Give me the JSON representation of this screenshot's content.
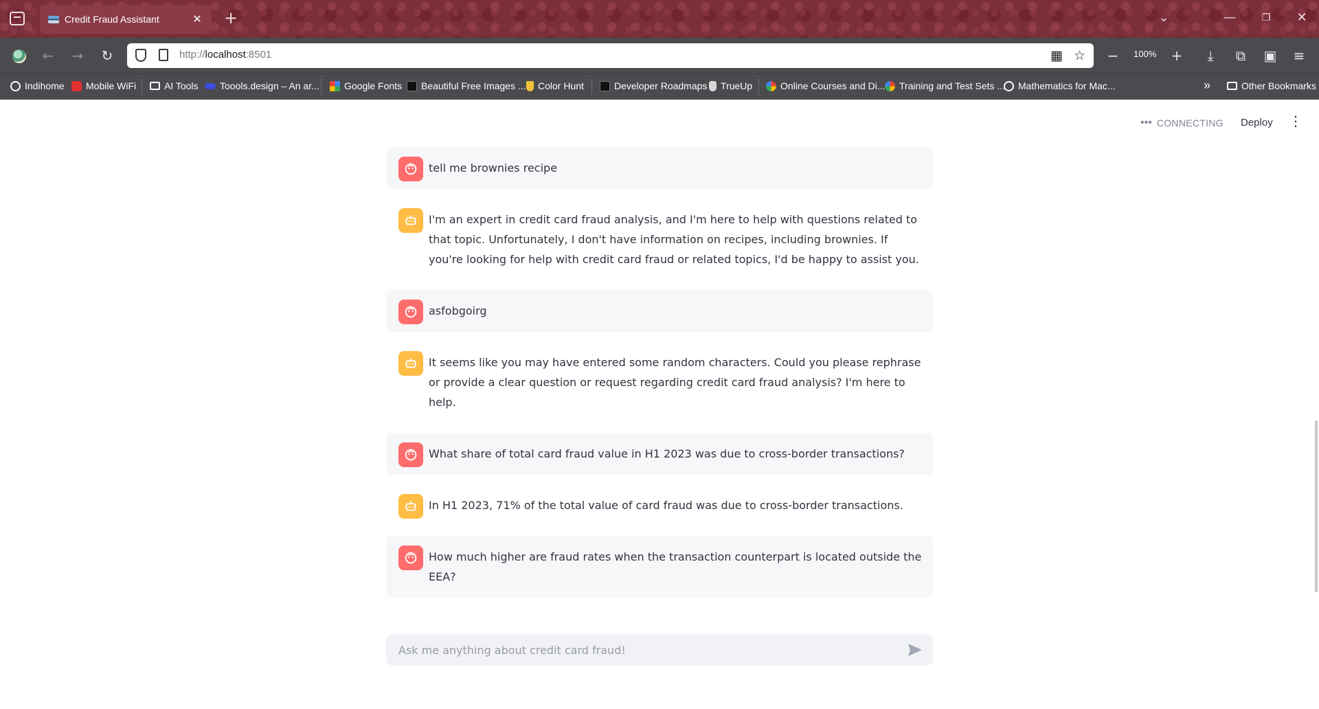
{
  "browser": {
    "tab_title": "Credit Fraud Assistant",
    "url_scheme": "http://",
    "url_host": "localhost",
    "url_port": ":8501",
    "zoom": "100%",
    "bookmarks": [
      {
        "label": "Indihome",
        "icon": "globe-icon"
      },
      {
        "label": "Mobile WiFi",
        "icon": "huawei-icon"
      },
      {
        "label": "AI Tools",
        "icon": "folder-icon"
      },
      {
        "label": "Toools.design – An ar...",
        "icon": "toools-icon"
      },
      {
        "label": "Google Fonts",
        "icon": "google-fonts-icon"
      },
      {
        "label": "Beautiful Free Images ...",
        "icon": "unsplash-icon"
      },
      {
        "label": "Color Hunt",
        "icon": "color-hunt-icon"
      },
      {
        "label": "Developer Roadmaps",
        "icon": "roadmap-icon"
      },
      {
        "label": "TrueUp",
        "icon": "trueup-icon"
      },
      {
        "label": "Online Courses and Di...",
        "icon": "google-icon"
      },
      {
        "label": "Training and Test Sets ...",
        "icon": "google-icon"
      },
      {
        "label": "Mathematics for Mac...",
        "icon": "globe-icon"
      }
    ],
    "other_bookmarks": "Other Bookmarks"
  },
  "app": {
    "status": "CONNECTING",
    "deploy_label": "Deploy",
    "messages": [
      {
        "role": "user",
        "text": "tell me brownies recipe"
      },
      {
        "role": "assistant",
        "text": "I'm an expert in credit card fraud analysis, and I'm here to help with questions related to that topic. Unfortunately, I don't have information on recipes, including brownies. If you're looking for help with credit card fraud or related topics, I'd be happy to assist you."
      },
      {
        "role": "user",
        "text": "asfobgoirg"
      },
      {
        "role": "assistant",
        "text": "It seems like you may have entered some random characters. Could you please rephrase or provide a clear question or request regarding credit card fraud analysis? I'm here to help."
      },
      {
        "role": "user",
        "text": "What share of total card fraud value in H1 2023 was due to cross-border transactions?"
      },
      {
        "role": "assistant",
        "text": "In H1 2023, 71% of the total value of card fraud was due to cross-border transactions."
      },
      {
        "role": "user",
        "text": "How much higher are fraud rates when the transaction counterpart is located outside the EEA?"
      }
    ],
    "chat_input": {
      "placeholder": "Ask me anything about credit card fraud!",
      "value": ""
    },
    "colors": {
      "user_avatar": "#ff6c6c",
      "assistant_avatar": "#ffbd45",
      "user_bubble": "#f6f7f9",
      "text": "#31333f"
    }
  }
}
